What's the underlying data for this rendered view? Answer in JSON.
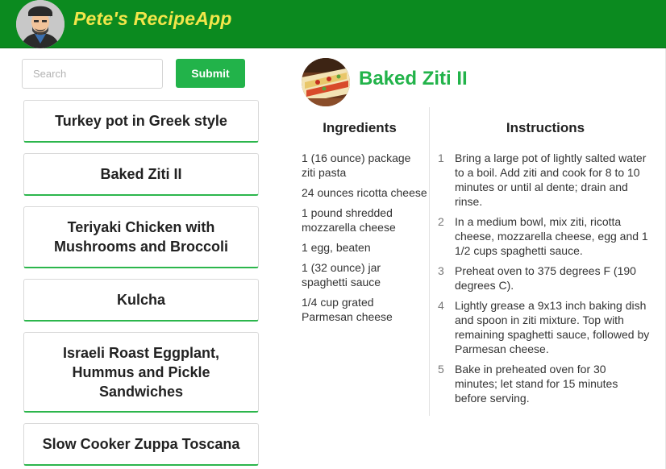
{
  "header": {
    "app_title": "Pete's RecipeApp",
    "brand_color": "#0b8a1f",
    "title_color": "#f2e64a"
  },
  "search": {
    "placeholder": "Search",
    "value": "",
    "submit_label": "Submit"
  },
  "recipes": [
    "Turkey pot in Greek style",
    "Baked Ziti II",
    "Teriyaki Chicken with Mushrooms and Broccoli",
    "Kulcha",
    "Israeli Roast Eggplant, Hummus and Pickle Sandwiches",
    "Slow Cooker Zuppa Toscana"
  ],
  "detail": {
    "title": "Baked Ziti II",
    "accent_color": "#22b34a",
    "ingredients_heading": "Ingredients",
    "ingredients": [
      "1 (16 ounce) package ziti pasta",
      "24 ounces ricotta cheese",
      "1 pound shredded mozzarella cheese",
      "1 egg, beaten",
      "1 (32 ounce) jar spaghetti sauce",
      "1/4 cup grated Parmesan cheese"
    ],
    "instructions_heading": "Instructions",
    "instructions": [
      {
        "num": "1",
        "text": "Bring a large pot of lightly salted water to a boil. Add ziti and cook for 8 to 10 minutes or until al dente; drain and rinse."
      },
      {
        "num": "2",
        "text": "In a medium bowl, mix ziti, ricotta cheese, mozzarella cheese, egg and 1 1/2 cups spaghetti sauce."
      },
      {
        "num": "3",
        "text": "Preheat oven to 375 degrees F (190 degrees C)."
      },
      {
        "num": "4",
        "text": "Lightly grease a 9x13 inch baking dish and spoon in ziti mixture. Top with remaining spaghetti sauce, followed by Parmesan cheese."
      },
      {
        "num": "5",
        "text": "Bake in preheated oven for 30 minutes; let stand for 15 minutes before serving."
      }
    ]
  }
}
